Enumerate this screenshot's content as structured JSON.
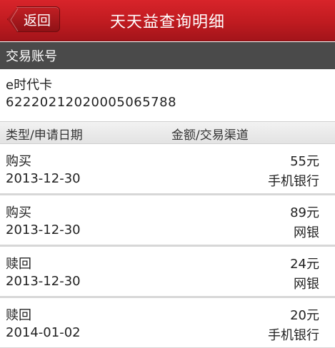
{
  "header": {
    "back_label": "返回",
    "title": "天天益查询明细"
  },
  "account": {
    "section_title": "交易账号",
    "card_type": "e时代卡",
    "card_number": "62220212020005065788"
  },
  "columns": {
    "left": "类型/申请日期",
    "right": "金额/交易渠道"
  },
  "records": [
    {
      "type": "购买",
      "date": "2013-12-30",
      "amount": "55元",
      "channel": "手机银行"
    },
    {
      "type": "购买",
      "date": "2013-12-30",
      "amount": "89元",
      "channel": "网银"
    },
    {
      "type": "赎回",
      "date": "2013-12-30",
      "amount": "24元",
      "channel": "网银"
    },
    {
      "type": "赎回",
      "date": "2014-01-02",
      "amount": "20元",
      "channel": "手机银行"
    }
  ],
  "colors": {
    "topbar": "#bf1b20",
    "section_header": "#4a4a4a",
    "divider": "#d7d7d7"
  },
  "icons": {
    "back": "chevron-left-icon"
  }
}
